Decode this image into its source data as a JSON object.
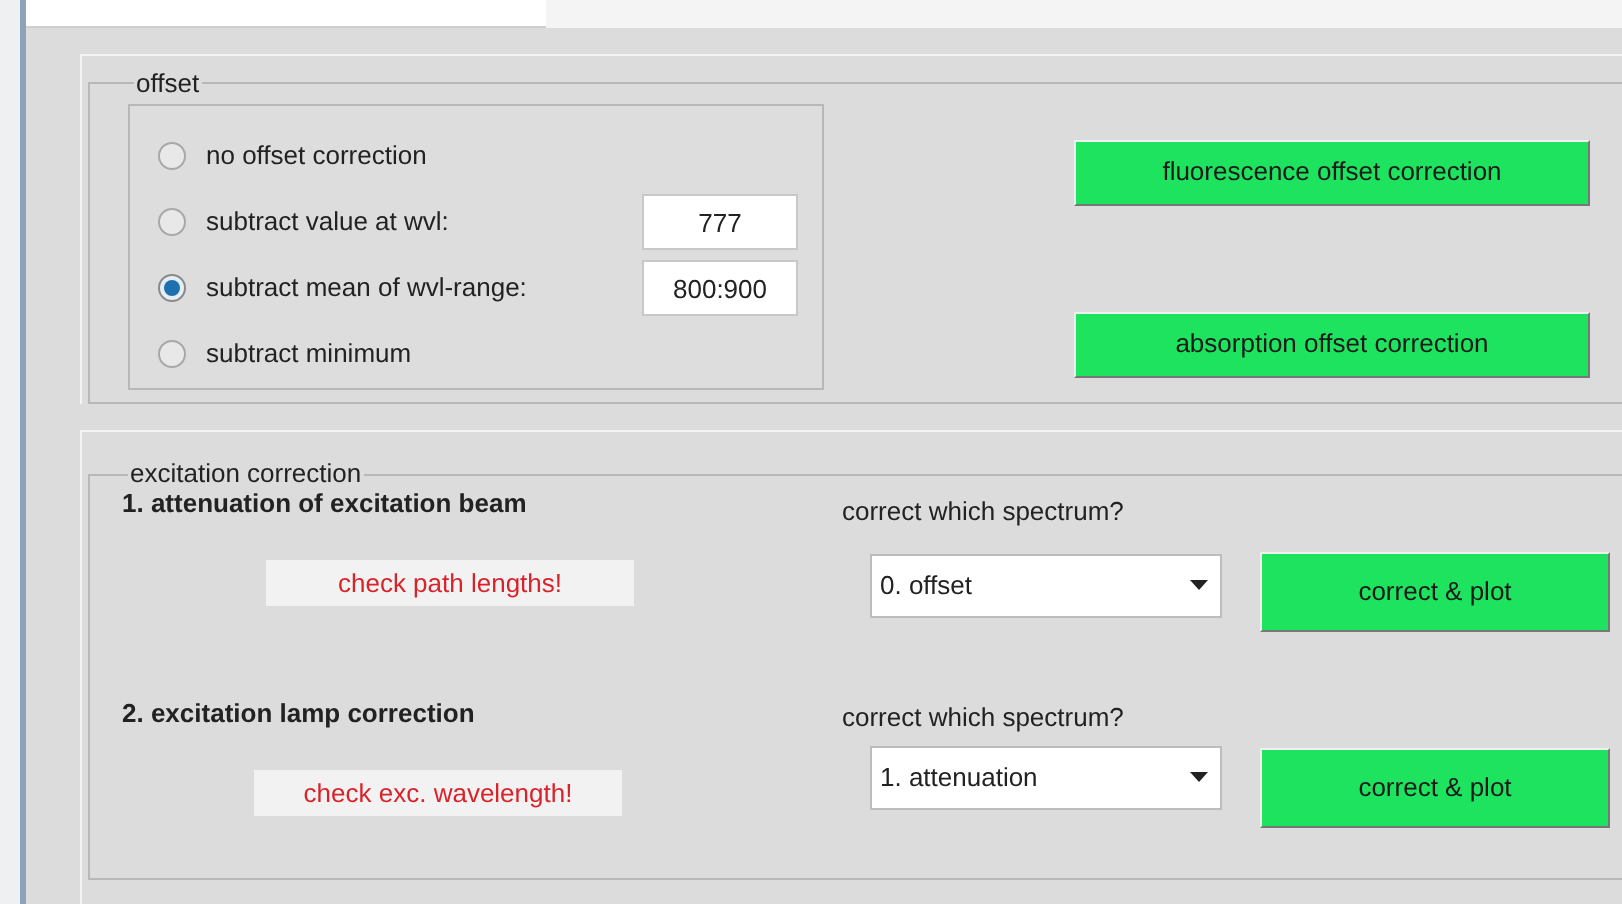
{
  "offset": {
    "title": "offset",
    "options": [
      {
        "label": "no offset correction",
        "selected": false
      },
      {
        "label": "subtract value at wvl:",
        "selected": false,
        "value": "777"
      },
      {
        "label": "subtract mean of wvl-range:",
        "selected": true,
        "value": "800:900"
      },
      {
        "label": "subtract minimum",
        "selected": false
      }
    ],
    "buttons": [
      "fluorescence offset correction",
      "absorption offset correction"
    ]
  },
  "excitation": {
    "title": "excitation correction",
    "steps": [
      {
        "heading": "1. attenuation of excitation beam",
        "warning": "check path lengths!",
        "prompt": "correct which spectrum?",
        "dropdown": "0. offset",
        "button": "correct & plot"
      },
      {
        "heading": "2. excitation lamp correction",
        "warning": "check exc. wavelength!",
        "prompt": "correct which spectrum?",
        "dropdown": "1. attenuation",
        "button": "correct & plot"
      }
    ]
  }
}
